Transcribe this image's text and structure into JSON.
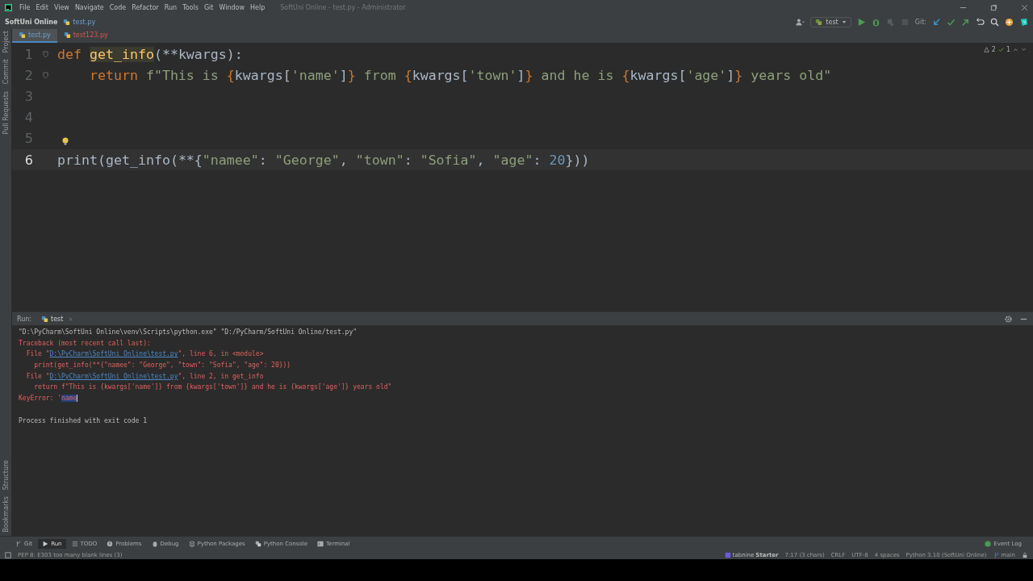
{
  "menu": [
    "File",
    "Edit",
    "View",
    "Navigate",
    "Code",
    "Refactor",
    "Run",
    "Tools",
    "Git",
    "Window",
    "Help"
  ],
  "window": {
    "title": "SoftUni Online - test.py - Administrator"
  },
  "breadcrumb": {
    "project": "SoftUni Online",
    "file": "test.py"
  },
  "run_config": "test",
  "git_label": "Git:",
  "tabs": [
    {
      "label": "test.py",
      "selected": true,
      "error": false
    },
    {
      "label": "test123.py",
      "selected": false,
      "error": true
    }
  ],
  "side_tools_top": [
    "Project",
    "Commit",
    "Pull Requests"
  ],
  "side_tools_bottom": [
    "Structure",
    "Bookmarks"
  ],
  "inspections": {
    "warnings": "2",
    "typos": "1"
  },
  "code_lines": [
    {
      "number": "1",
      "current": false,
      "fold": true,
      "bulb": false,
      "tokens": [
        {
          "kind": "kw",
          "text": "def "
        },
        {
          "kind": "fn",
          "text": "get_info"
        },
        {
          "kind": "plain",
          "text": "(**kwargs):"
        }
      ]
    },
    {
      "number": "2",
      "current": false,
      "fold": true,
      "bulb": false,
      "tokens": [
        {
          "kind": "kw",
          "text": "    return "
        },
        {
          "kind": "str",
          "text": "f\"This is "
        },
        {
          "kind": "brace",
          "text": "{"
        },
        {
          "kind": "plain",
          "text": "kwargs["
        },
        {
          "kind": "str",
          "text": "'name'"
        },
        {
          "kind": "plain",
          "text": "]"
        },
        {
          "kind": "brace",
          "text": "}"
        },
        {
          "kind": "str",
          "text": " from "
        },
        {
          "kind": "brace",
          "text": "{"
        },
        {
          "kind": "plain",
          "text": "kwargs["
        },
        {
          "kind": "str",
          "text": "'town'"
        },
        {
          "kind": "plain",
          "text": "]"
        },
        {
          "kind": "brace",
          "text": "}"
        },
        {
          "kind": "str",
          "text": " and he is "
        },
        {
          "kind": "brace",
          "text": "{"
        },
        {
          "kind": "plain",
          "text": "kwargs["
        },
        {
          "kind": "str",
          "text": "'age'"
        },
        {
          "kind": "plain",
          "text": "]"
        },
        {
          "kind": "brace",
          "text": "}"
        },
        {
          "kind": "str",
          "text": " years old\""
        }
      ]
    },
    {
      "number": "3",
      "current": false,
      "fold": false,
      "bulb": false
    },
    {
      "number": "4",
      "current": false,
      "fold": false,
      "bulb": false
    },
    {
      "number": "5",
      "current": false,
      "fold": false,
      "bulb": true
    },
    {
      "number": "6",
      "current": true,
      "fold": false,
      "bulb": false,
      "tokens": [
        {
          "kind": "plain",
          "text": "print("
        },
        {
          "kind": "plain",
          "text": "get_info"
        },
        {
          "kind": "plain",
          "text": "(**{"
        },
        {
          "kind": "str",
          "text": "\"namee\""
        },
        {
          "kind": "plain",
          "text": ": "
        },
        {
          "kind": "str",
          "text": "\"George\""
        },
        {
          "kind": "plain",
          "text": ", "
        },
        {
          "kind": "str",
          "text": "\"town\""
        },
        {
          "kind": "plain",
          "text": ": "
        },
        {
          "kind": "str",
          "text": "\"Sofia\""
        },
        {
          "kind": "plain",
          "text": ", "
        },
        {
          "kind": "str",
          "text": "\"age\""
        },
        {
          "kind": "plain",
          "text": ": "
        },
        {
          "kind": "num",
          "text": "20"
        },
        {
          "kind": "plain",
          "text": "}))"
        }
      ]
    }
  ],
  "run_panel": {
    "label": "Run:",
    "tab": "test"
  },
  "console_lines": [
    [
      {
        "kind": "out",
        "text": "\"D:\\PyCharm\\SoftUni Online\\venv\\Scripts\\python.exe\" \"D:/PyCharm/SoftUni Online/test.py\""
      }
    ],
    [
      {
        "kind": "err",
        "text": "Traceback (most recent call last):"
      }
    ],
    [
      {
        "kind": "err",
        "text": "  File \""
      },
      {
        "kind": "link",
        "text": "D:\\PyCharm\\SoftUni Online\\test.py"
      },
      {
        "kind": "err",
        "text": "\", line 6, in <module>"
      }
    ],
    [
      {
        "kind": "err",
        "text": "    print(get_info(**{\"namee\": \"George\", \"town\": \"Sofia\", \"age\": 20}))"
      }
    ],
    [
      {
        "kind": "err",
        "text": "  File \""
      },
      {
        "kind": "link",
        "text": "D:\\PyCharm\\SoftUni Online\\test.py"
      },
      {
        "kind": "err",
        "text": "\", line 2, in get_info"
      }
    ],
    [
      {
        "kind": "err",
        "text": "    return f\"This is {kwargs['name']} from {kwargs['town']} and he is {kwargs['age']} years old\""
      }
    ],
    [
      {
        "kind": "err",
        "text": "KeyError: '"
      },
      {
        "kind": "selection",
        "text": "name"
      }
    ]
  ],
  "console_footer": "Process finished with exit code 1",
  "tool_tabs": [
    {
      "label": "Git",
      "kind": "git",
      "selected": false
    },
    {
      "label": "Run",
      "kind": "run",
      "selected": true
    },
    {
      "label": "TODO",
      "kind": "list",
      "selected": false
    },
    {
      "label": "Problems",
      "kind": "info",
      "selected": false
    },
    {
      "label": "Debug",
      "kind": "bug",
      "selected": false
    },
    {
      "label": "Python Packages",
      "kind": "stack",
      "selected": false
    },
    {
      "label": "Python Console",
      "kind": "python",
      "selected": false
    },
    {
      "label": "Terminal",
      "kind": "terminal",
      "selected": false
    }
  ],
  "event_log": "Event Log",
  "status_bar": {
    "message": "PEP 8: E303 too many blank lines (3)",
    "tabnine": "tabnine",
    "tabnine_plan": "Starter",
    "items": [
      "7:17 (3 chars)",
      "CRLF",
      "UTF-8",
      "4 spaces",
      "Python 3.10 (SoftUni Online)"
    ],
    "branch": "main"
  }
}
